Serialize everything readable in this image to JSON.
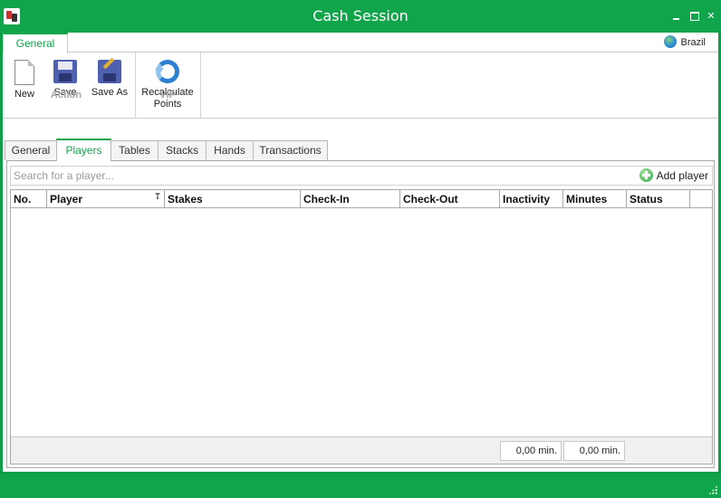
{
  "window": {
    "title": "Cash Session"
  },
  "ribbon": {
    "tabs": [
      {
        "label": "General"
      }
    ],
    "locale": "Brazil",
    "groups": [
      {
        "label": "Action",
        "buttons": [
          {
            "label": "New"
          },
          {
            "label": "Save"
          },
          {
            "label": "Save As"
          }
        ]
      },
      {
        "label": "VIP",
        "buttons": [
          {
            "label": "Recalculate Points",
            "line1": "Recalculate",
            "line2": "Points"
          }
        ]
      }
    ]
  },
  "tabs": [
    {
      "label": "General"
    },
    {
      "label": "Players"
    },
    {
      "label": "Tables"
    },
    {
      "label": "Stacks"
    },
    {
      "label": "Hands"
    },
    {
      "label": "Transactions"
    }
  ],
  "active_tab": "Players",
  "search": {
    "placeholder": "Search for a player...",
    "value": ""
  },
  "add_player": {
    "label": "Add player"
  },
  "grid": {
    "columns": [
      {
        "label": "No."
      },
      {
        "label": "Player"
      },
      {
        "label": "Stakes"
      },
      {
        "label": "Check-In"
      },
      {
        "label": "Check-Out"
      },
      {
        "label": "Inactivity"
      },
      {
        "label": "Minutes"
      },
      {
        "label": "Status"
      }
    ],
    "rows": [],
    "footer": {
      "inactivity_total": "0,00 min.",
      "minutes_total": "0,00 min."
    }
  },
  "colors": {
    "accent": "#10a54a",
    "border": "#a8a8a8"
  },
  "icons": [
    "cards-app-icon",
    "minimize-icon",
    "maximize-icon",
    "close-icon",
    "globe-icon",
    "new-document-icon",
    "save-disk-icon",
    "save-as-icon",
    "refresh-icon",
    "filter-icon",
    "add-circle-icon",
    "resize-grip-icon"
  ]
}
